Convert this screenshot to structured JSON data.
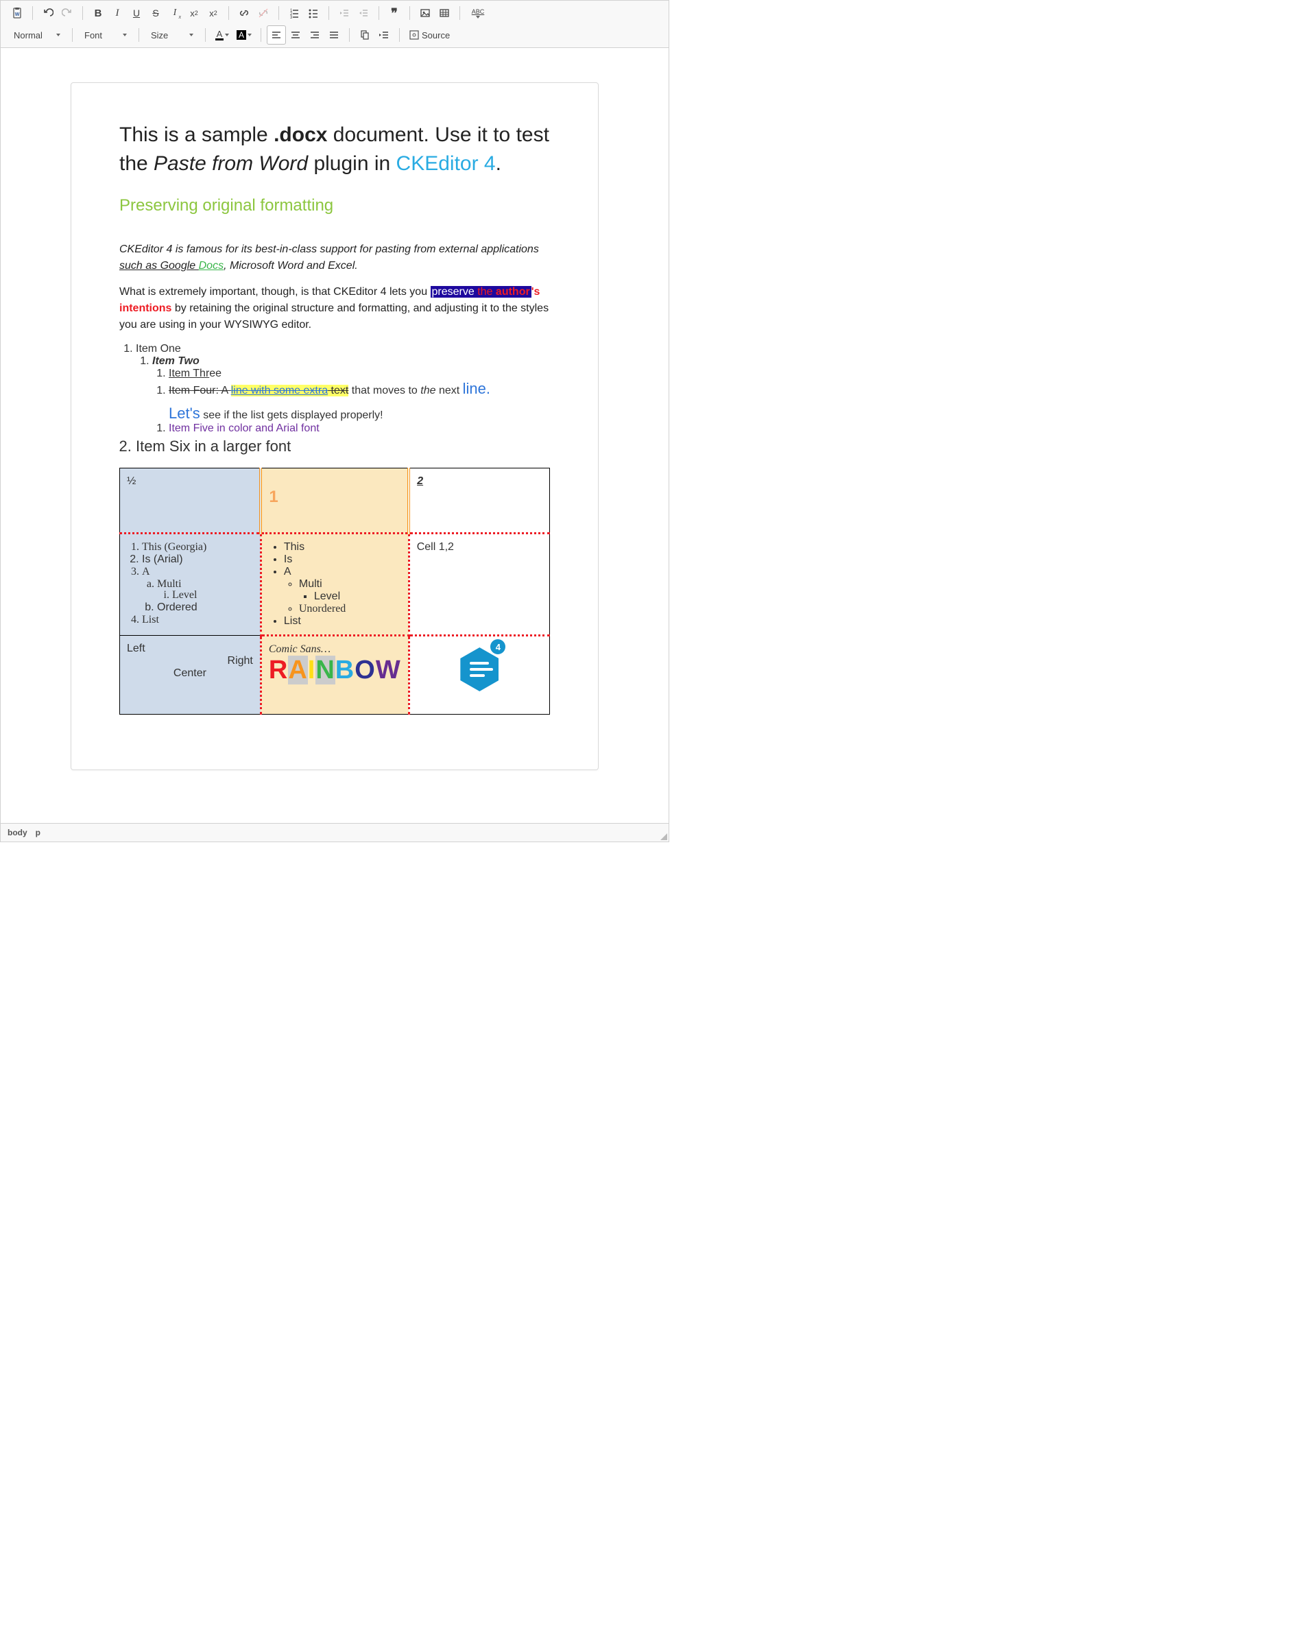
{
  "toolbar": {
    "row1": {
      "pasteFromWord": "Paste from Word",
      "undo": "Undo",
      "redo": "Redo",
      "bold": "B",
      "italic": "I",
      "underline": "U",
      "strike": "S",
      "removeFormat": "Tx",
      "subscript": "x₂",
      "superscript": "x²",
      "link": "Link",
      "unlink": "Unlink",
      "numList": "Numbered List",
      "bulList": "Bulleted List",
      "outdent": "Outdent",
      "indent": "Indent",
      "blockquote": "❝❞",
      "image": "Image",
      "table": "Table",
      "spellcheck": "ABC"
    },
    "row2": {
      "format": "Normal",
      "font": "Font",
      "size": "Size",
      "textColor": "A",
      "bgColor": "A",
      "alignLeft": "Align Left",
      "alignCenter": "Center",
      "alignRight": "Align Right",
      "justify": "Justify",
      "copyFormat": "Copy Formatting",
      "indentIcon": "Indent",
      "showBlocks": "Show Blocks",
      "source": "Source"
    }
  },
  "content": {
    "title_pre": "This is a sample ",
    "title_strong": ".docx",
    "title_mid": " document. Use it to test the ",
    "title_em": "Paste from Word",
    "title_after_em": " plugin in ",
    "title_link": "CKEditor 4",
    "title_end": ".",
    "subheading": "Preserving original formatting",
    "p1_a": "CKEditor 4 is famous for its best-in-class support for pasting from external applications ",
    "p1_sucha": "such as Google ",
    "p1_docs": "Docs",
    "p1_b": ", Microsoft Word and Excel.",
    "p2_a": "What is extremely important, though, is that CKEditor 4 lets you ",
    "p2_preserve": "preserve",
    "p2_the": "the ",
    "p2_author": "author",
    "p2_s": "'s intentions",
    "p2_b": " by retaining the original structure and formatting, and adjusting it to the styles you are using in your WYSIWYG editor.",
    "li1": "Item One",
    "li2": "Item Two",
    "li3_a": "Item Thr",
    "li3_b": "ee",
    "li4_a": "Item Four: A ",
    "li4_b": "line with some extra",
    "li4_c": " text",
    "li4_d": " that moves to ",
    "li4_e": "the",
    "li4_f": " next ",
    "li4_g": "line.",
    "li4_lets": "Let's",
    "li4_rest": " see if the list gets displayed properly!",
    "li5": "Item Five in color and Arial font",
    "li6": "Item Six in a larger font"
  },
  "table": {
    "r1c1": "½",
    "r1c2": "1",
    "r1c3": "2",
    "r2c3": "Cell 1,2",
    "ordered": [
      "This (Georgia)",
      "Is (Arial)",
      "A",
      "Multi",
      "Level",
      "Ordered",
      "List"
    ],
    "unordered": [
      "This",
      "Is",
      "A",
      "Multi",
      "Level",
      "Unordered",
      "List"
    ],
    "r3c1_left": "Left",
    "r3c1_right": "Right",
    "r3c1_center": "Center",
    "r3c2_comic": "Comic Sans…",
    "rainbow": [
      "R",
      "A",
      "I",
      "N",
      "B",
      "O",
      "W"
    ],
    "badge": "4"
  },
  "pathbar": {
    "body": "body",
    "p": "p"
  }
}
